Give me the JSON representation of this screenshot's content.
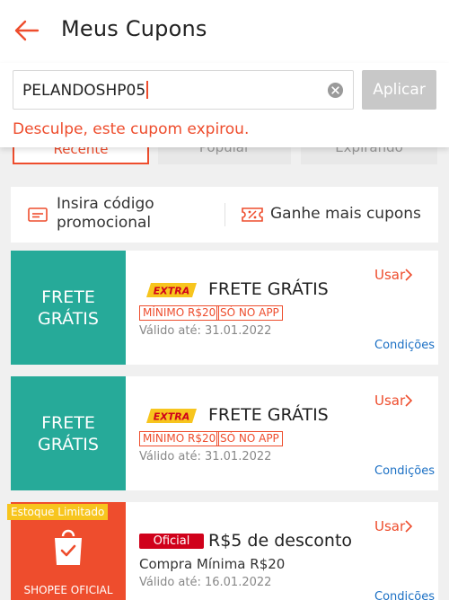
{
  "header": {
    "title": "Meus Cupons",
    "back_icon": "arrow-left-icon"
  },
  "code_entry": {
    "value": "PELANDOSHP05",
    "clear_icon": "clear-circle-icon",
    "apply_label": "Aplicar",
    "error": "Desculpe, este cupom expirou."
  },
  "tabs": [
    {
      "label": "Recente",
      "active": true
    },
    {
      "label": "Popular",
      "active": false
    },
    {
      "label": "Expirando",
      "active": false
    }
  ],
  "actions": {
    "promo_line1": "Insira código",
    "promo_line2": "promocional",
    "more": "Ganhe mais cupons"
  },
  "vouchers": [
    {
      "left_line1": "FRETE",
      "left_line2": "GRÁTIS",
      "logo_text": "EXTRA",
      "title": "FRETE GRÁTIS",
      "tag1": "MÍNIMO R$20",
      "tag2": "SÓ NO APP",
      "valid": "Válido até: 31.01.2022",
      "use": "Usar",
      "conditions": "Condições",
      "color": "#26aa99"
    },
    {
      "left_line1": "FRETE",
      "left_line2": "GRÁTIS",
      "logo_text": "EXTRA",
      "title": "FRETE GRÁTIS",
      "tag1": "MÍNIMO R$20",
      "tag2": "SÓ NO APP",
      "valid": "Válido até: 31.01.2022",
      "use": "Usar",
      "conditions": "Condições",
      "color": "#26aa99"
    },
    {
      "badge": "Estoque Limitado",
      "shop_label": "SHOPEE OFICIAL",
      "official": "Oficial",
      "title": "R$5 de desconto",
      "min": "Compra Mínima R$20",
      "valid": "Válido até: 16.01.2022",
      "use": "Usar",
      "conditions": "Condições",
      "color": "#ee4d2d"
    }
  ],
  "colors": {
    "accent": "#ee4d2d",
    "teal": "#26aa99",
    "link": "#1a6fc4",
    "yellow": "#f7c51e"
  }
}
